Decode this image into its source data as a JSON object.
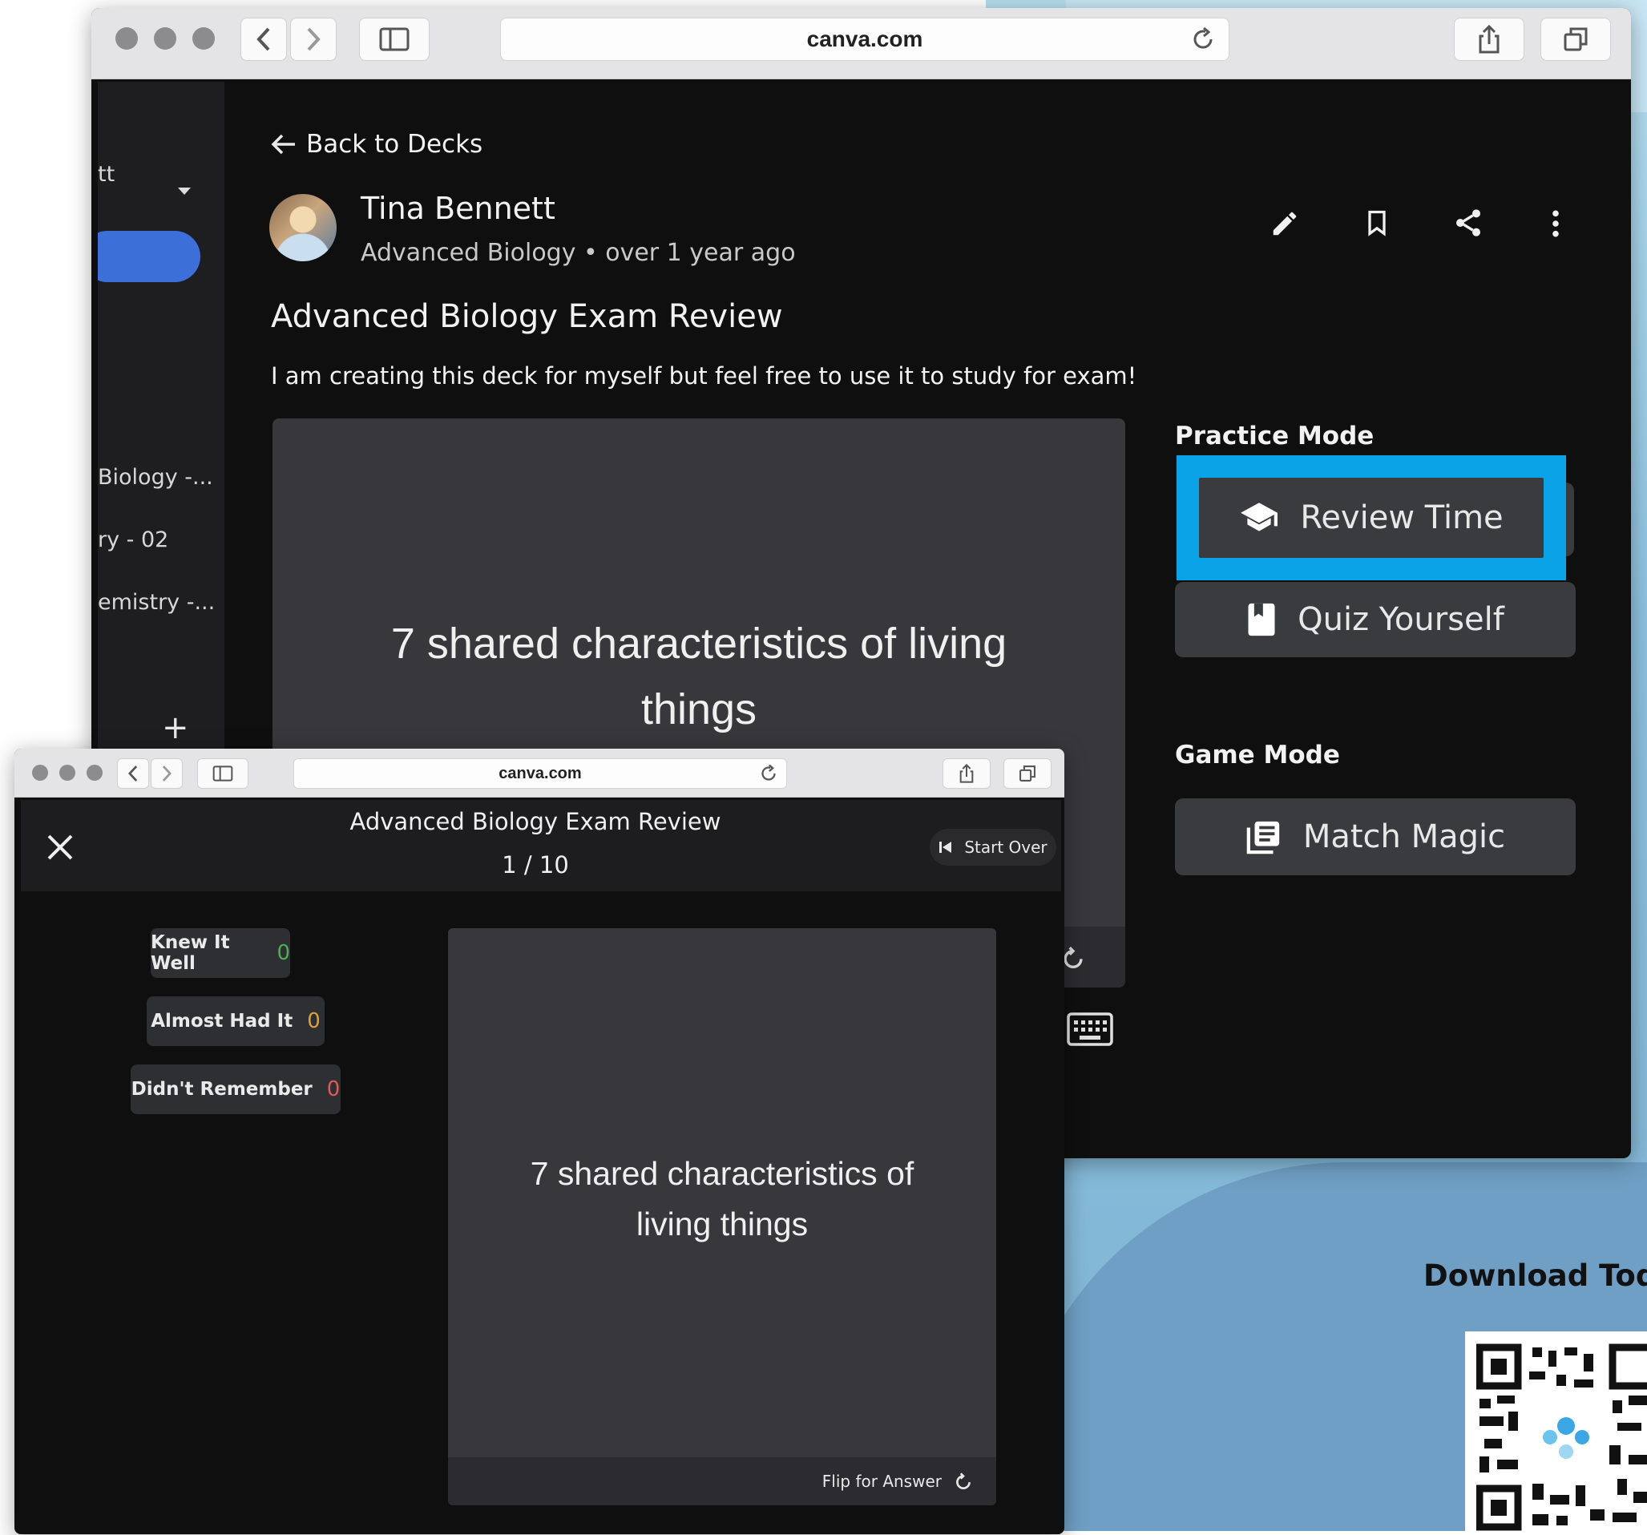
{
  "main_window": {
    "url": "canva.com",
    "sidebar": {
      "user_fragment": "tt",
      "items": [
        "Biology -...",
        "ry - 02",
        "emistry -..."
      ],
      "add_label": "+"
    },
    "back_link": "Back to Decks",
    "author": {
      "name": "Tina Bennett",
      "meta": "Advanced Biology • over 1 year ago"
    },
    "deck": {
      "title": "Advanced Biology Exam Review",
      "description": "I am creating this deck for myself but feel free to use it to study for exam!",
      "card_text": "7 shared characteristics of living things"
    },
    "practice_mode": {
      "heading": "Practice Mode",
      "review_label": "Review Time",
      "quiz_label": "Quiz Yourself"
    },
    "game_mode": {
      "heading": "Game Mode",
      "match_label": "Match Magic"
    },
    "highlight_color": "#0aa3e8"
  },
  "popup_window": {
    "url": "canva.com",
    "title": "Advanced Biology Exam Review",
    "progress": "1 / 10",
    "start_over": "Start Over",
    "scores": [
      {
        "label": "Knew It Well",
        "count": "0",
        "color": "#4caf50"
      },
      {
        "label": "Almost Had It",
        "count": "0",
        "color": "#e0a040"
      },
      {
        "label": "Didn't Remember",
        "count": "0",
        "color": "#e05a5a"
      }
    ],
    "card_text": "7 shared characteristics of living things",
    "flip_label": "Flip for Answer"
  },
  "promo": {
    "download_text": "Download Tod"
  }
}
